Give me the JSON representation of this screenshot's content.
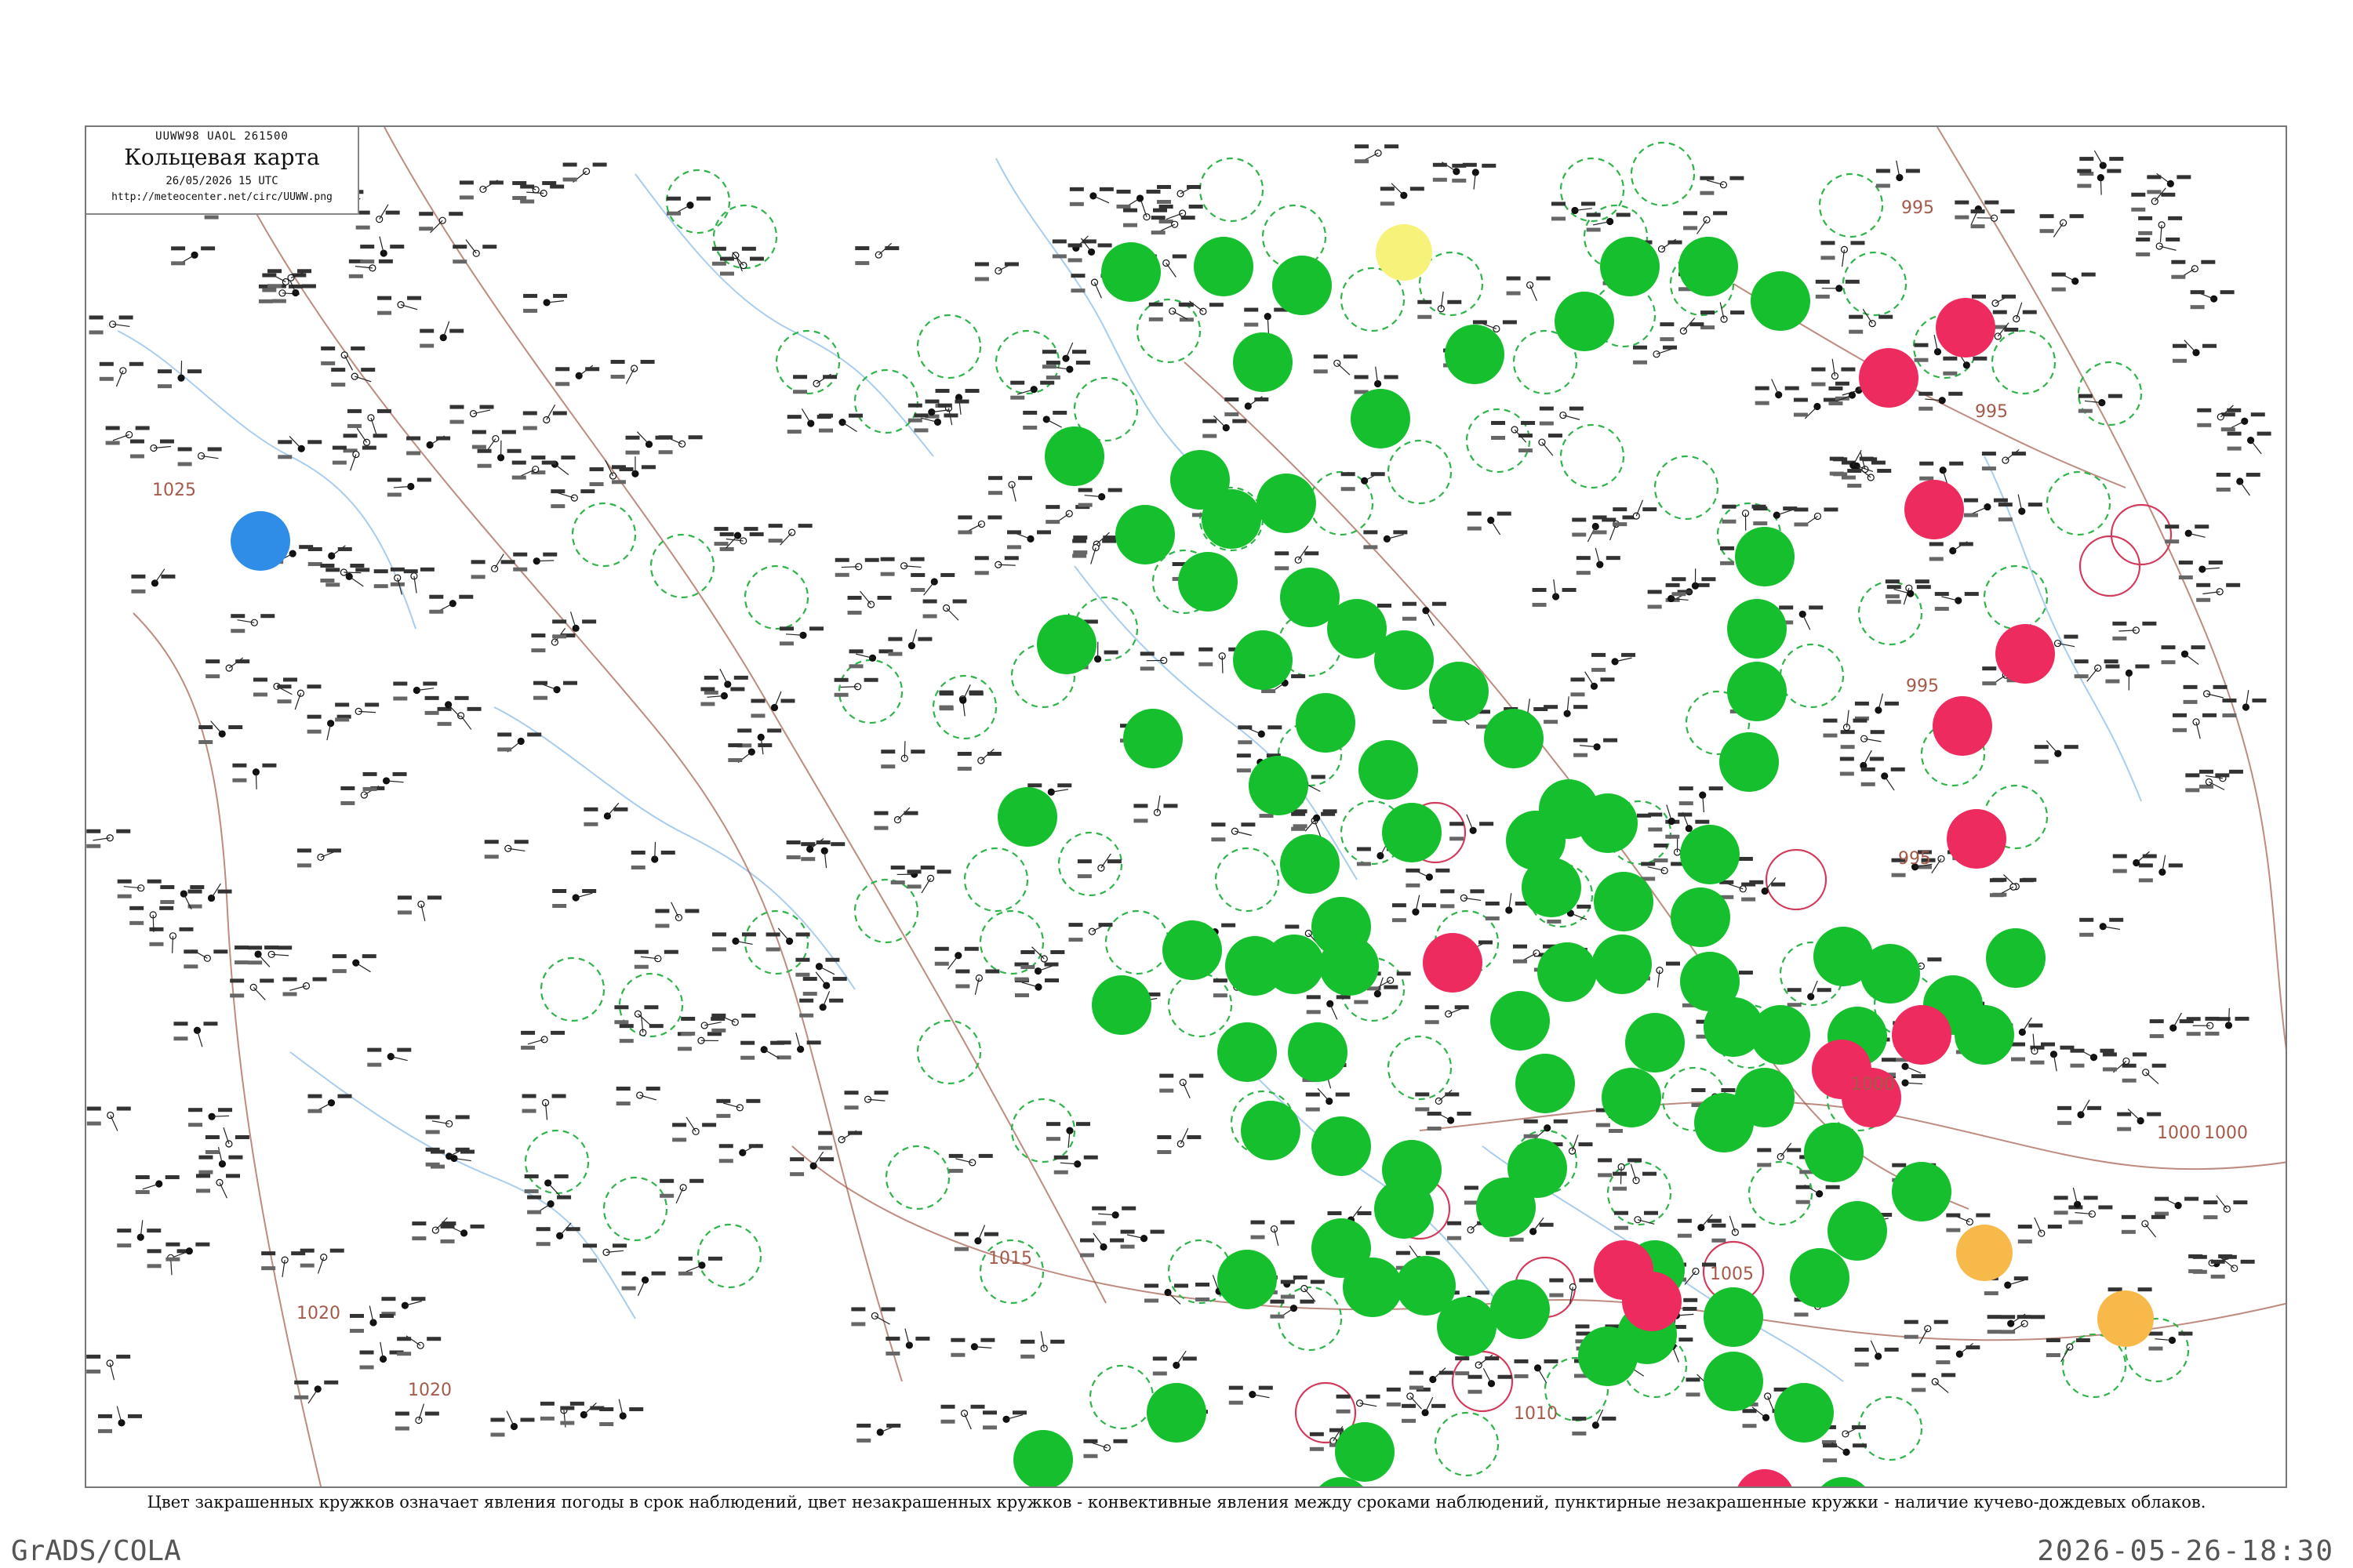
{
  "header": {
    "code": "UUWW98 UAOL 261500",
    "title": "Кольцевая карта",
    "time": "26/05/2026 15 UTC",
    "url": "http://meteocenter.net/circ/UUWW.png"
  },
  "caption": "Цвет закрашенных кружков означает явления погоды в срок наблюдений, цвет незакрашенных кружков - конвективные явления между сроками наблюдений, пунктирные незакрашенные кружки - наличие кучево-дождевых облаков.",
  "footer": {
    "left": "GrADS/COLA",
    "right": "2026-05-26-18:30"
  },
  "isobar_labels": [
    "1025",
    "1020",
    "1020",
    "1015",
    "1010",
    "1005",
    "1000",
    "1000",
    "1000",
    "995",
    "995",
    "995",
    "995"
  ],
  "colors": {
    "green": "#15bf2e",
    "red": "#ee2b5e",
    "blue": "#2f8de8",
    "yellow": "#f7f27a",
    "orange": "#f6b94a",
    "isobar": "#a35a4a",
    "river": "#a9cdee",
    "dashed_ring": "#2fb34a",
    "red_ring": "#d23a5a"
  },
  "legend_note": "filled circles = weather phenomena at observation time; open circles = convective phenomena between observations; dashed open circles = cumulonimbus clouds"
}
